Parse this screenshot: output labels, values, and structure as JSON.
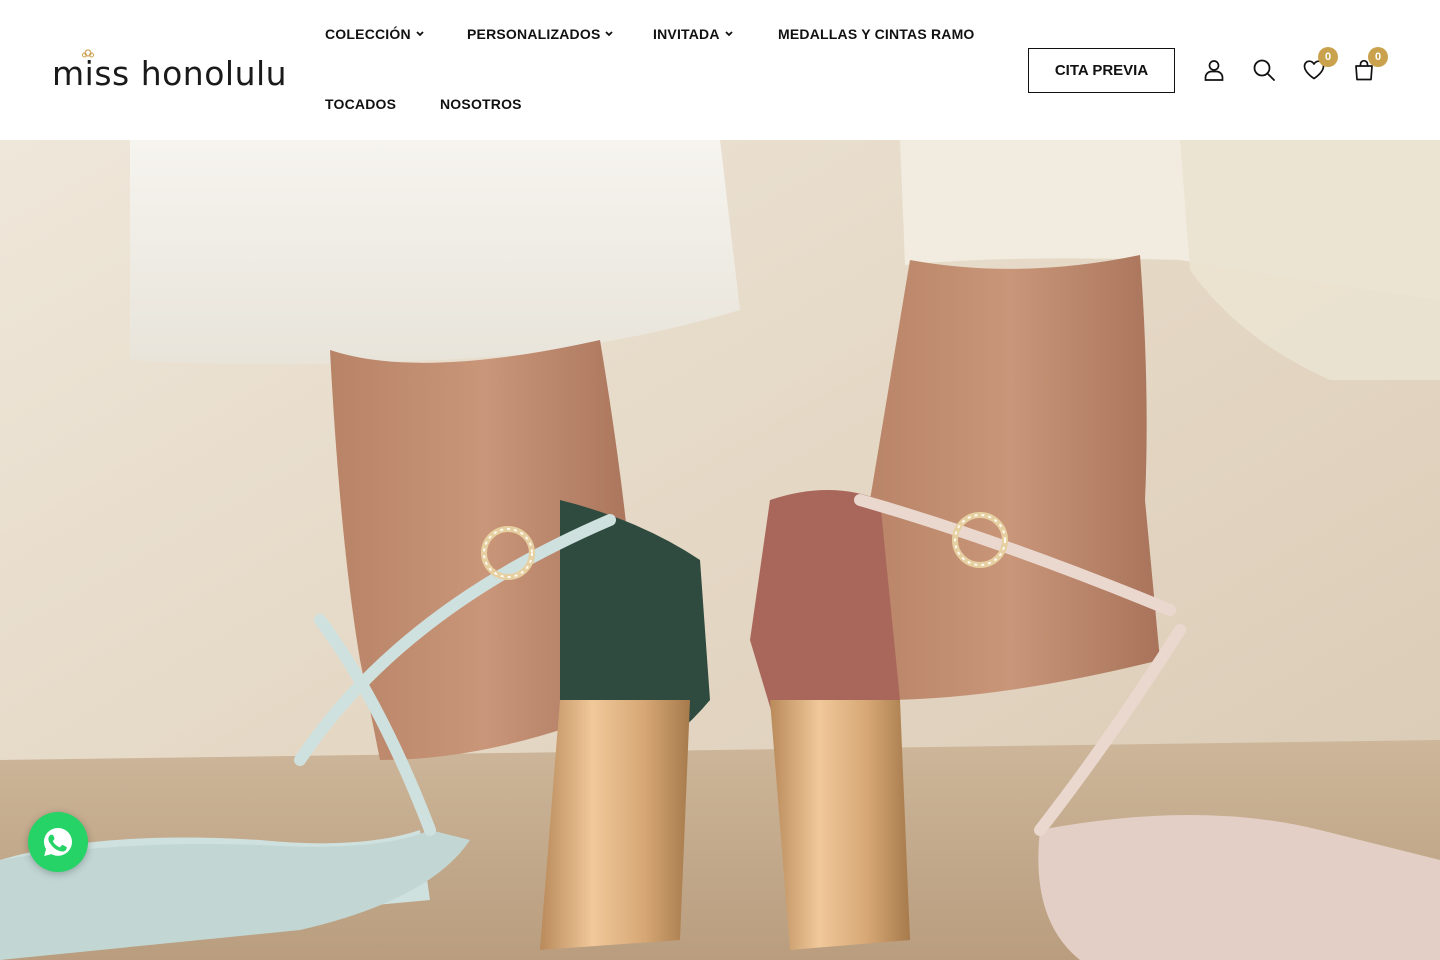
{
  "brand": {
    "name": "miss honolulu",
    "accent_color": "#caa24e"
  },
  "nav": {
    "items": [
      {
        "label": "COLECCIÓN",
        "has_dropdown": true
      },
      {
        "label": "PERSONALIZADOS",
        "has_dropdown": true
      },
      {
        "label": "INVITADA",
        "has_dropdown": true
      },
      {
        "label": "MEDALLAS Y CINTAS RAMO",
        "has_dropdown": false
      },
      {
        "label": "TOCADOS",
        "has_dropdown": false
      },
      {
        "label": "NOSOTROS",
        "has_dropdown": false
      }
    ]
  },
  "header": {
    "cta_label": "CITA PREVIA",
    "icons": [
      "user-icon",
      "search-icon",
      "heart-icon",
      "bag-icon"
    ],
    "wishlist_count": "0",
    "cart_count": "0"
  },
  "hero": {
    "image": "hero-photo",
    "colors": {
      "backdrop": "#e9dfcf",
      "mint_shoe": "#cfe1df",
      "green_heel": "#2f4b3f",
      "blush_shoe": "#e3cfc5",
      "rose_heel": "#a8675a",
      "gold_heel": "#d6a774"
    }
  },
  "whatsapp": {
    "icon": "whatsapp-icon",
    "color": "#25d366"
  }
}
